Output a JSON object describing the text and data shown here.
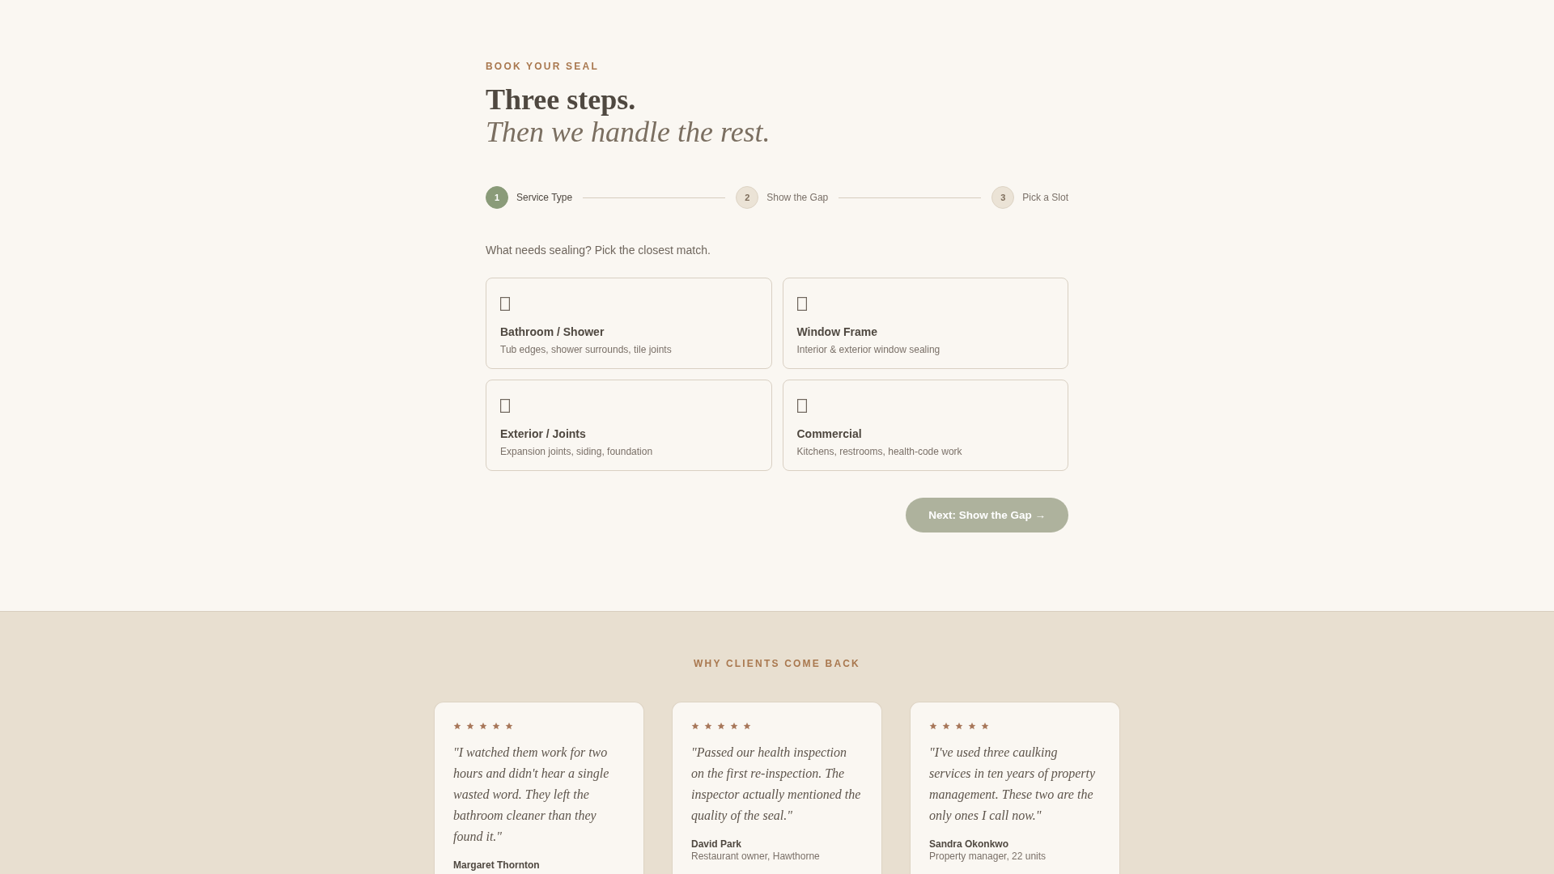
{
  "booking": {
    "eyebrow": "BOOK YOUR SEAL",
    "title": "Three steps.",
    "subtitle": "Then we handle the rest.",
    "steps": [
      {
        "number": "1",
        "label": "Service Type",
        "selected": true
      },
      {
        "number": "2",
        "label": "Show the Gap",
        "selected": false
      },
      {
        "number": "3",
        "label": "Pick a Slot",
        "selected": false
      }
    ],
    "prompt": "What needs sealing? Pick the closest match.",
    "services": [
      {
        "title": "Bathroom / Shower",
        "description": "Tub edges, shower surrounds, tile joints",
        "selected": false
      },
      {
        "title": "Window Frame",
        "description": "Interior & exterior window sealing",
        "selected": false
      },
      {
        "title": "Exterior / Joints",
        "description": "Expansion joints, siding, foundation",
        "selected": false
      },
      {
        "title": "Commercial",
        "description": "Kitchens, restrooms, health-code work",
        "selected": false
      }
    ],
    "next_button": {
      "label": "Next: Show the Gap →",
      "disabled": true
    }
  },
  "testimonials": {
    "heading": "WHY CLIENTS COME BACK",
    "items": [
      {
        "stars": 5,
        "quote": "\"I watched them work for two hours and didn't hear a single wasted word. They left the bathroom cleaner than they found it.\"",
        "name": "Margaret Thornton"
      },
      {
        "stars": 5,
        "quote": "\"Passed our health inspection on the first re-inspection. The inspector actually mentioned the quality of the seal.\"",
        "name": "David Park",
        "role": "Restaurant owner, Hawthorne"
      },
      {
        "stars": 5,
        "quote": "\"I've used three caulking services in ten years of property management. These two are the only ones I call now.\"",
        "name": "Sandra Okonkwo",
        "role": "Property manager, 22 units"
      }
    ]
  }
}
